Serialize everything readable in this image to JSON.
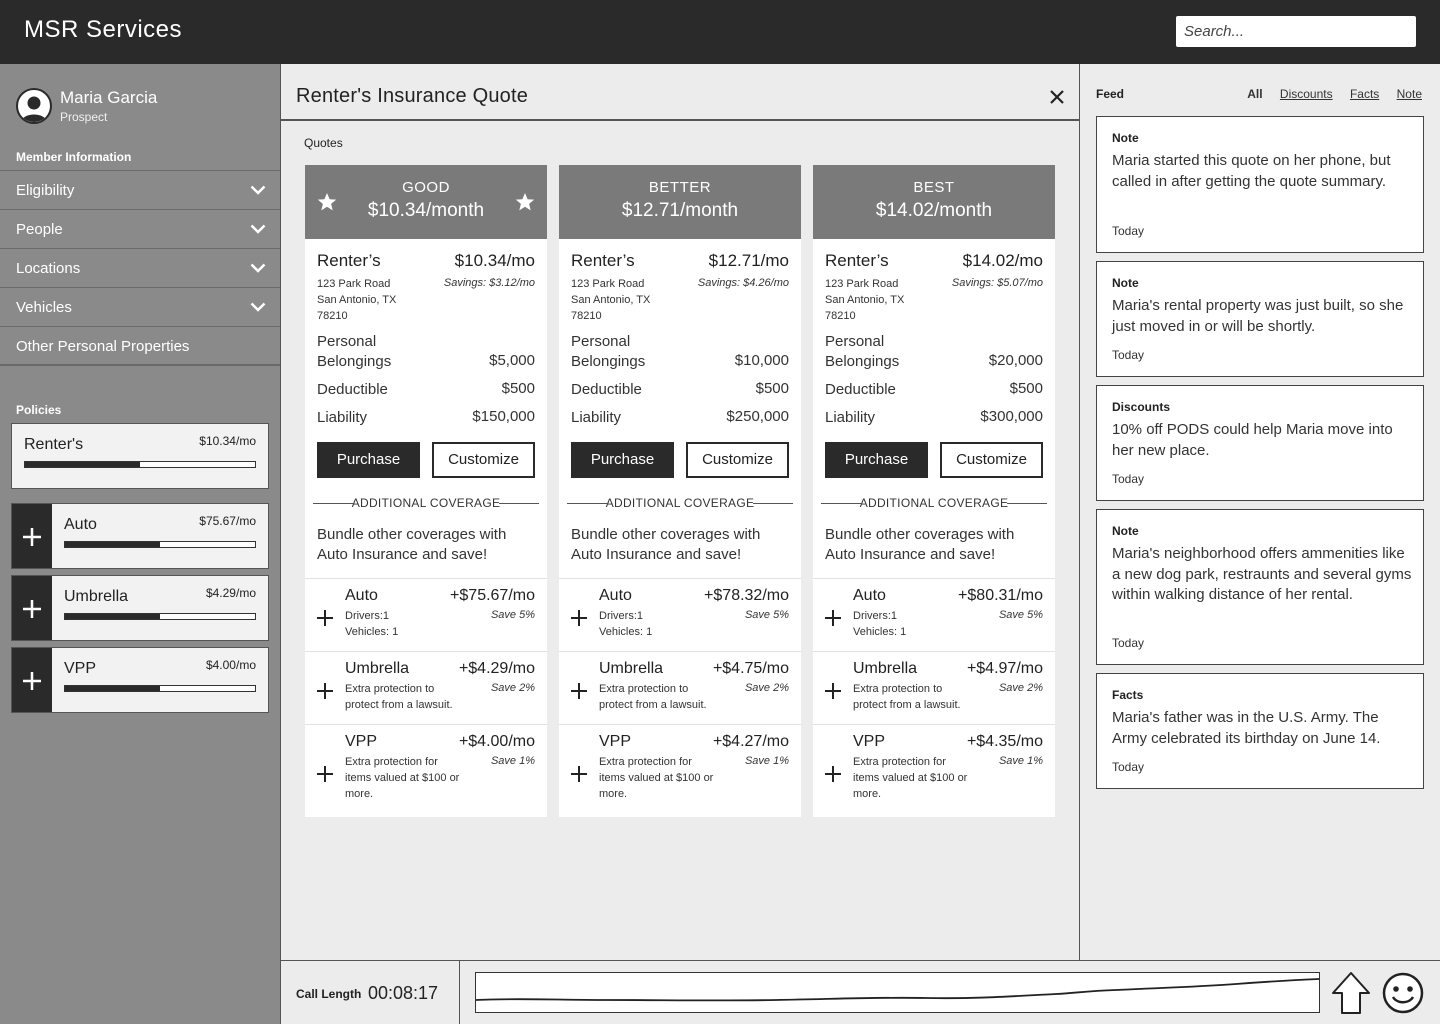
{
  "app": {
    "title": "MSR Services",
    "search_placeholder": "Search..."
  },
  "member": {
    "name": "Maria Garcia",
    "role": "Prospect"
  },
  "sidebar": {
    "section_label": "Member Information",
    "items": [
      {
        "label": "Eligibility",
        "expandable": true
      },
      {
        "label": "People",
        "expandable": true
      },
      {
        "label": "Locations",
        "expandable": true
      },
      {
        "label": "Vehicles",
        "expandable": true
      },
      {
        "label": "Other Personal Properties",
        "expandable": false
      }
    ],
    "policies_label": "Policies",
    "policies": [
      {
        "name": "Renter's",
        "price": "$10.34/mo",
        "progress": 0.5,
        "addable": false
      },
      {
        "name": "Auto",
        "price": "$75.67/mo",
        "progress": 0.5,
        "addable": true
      },
      {
        "name": "Umbrella",
        "price": "$4.29/mo",
        "progress": 0.5,
        "addable": true
      },
      {
        "name": "VPP",
        "price": "$4.00/mo",
        "progress": 0.5,
        "addable": true
      }
    ]
  },
  "quote": {
    "title": "Renter's Insurance Quote",
    "quotes_label": "Quotes",
    "purchase_label": "Purchase",
    "customize_label": "Customize",
    "additional_coverage_label": "ADDITIONAL COVERAGE",
    "bundle_text": "Bundle other coverages with Auto Insurance and save!",
    "row_labels": {
      "belongings": "Personal Belongings",
      "deductible": "Deductible",
      "liability": "Liability"
    },
    "address": [
      "123 Park Road",
      "San Antonio, TX",
      "78210"
    ],
    "cards": [
      {
        "tier": "GOOD",
        "tier_price": "$10.34/month",
        "starred": true,
        "name": "Renter’s",
        "price": "$10.34/mo",
        "savings": "Savings: $3.12/mo",
        "belongings": "$5,000",
        "deductible": "$500",
        "liability": "$150,000",
        "coverages": [
          {
            "name": "Auto",
            "price": "+$75.67/mo",
            "desc": "Drivers:1\nVehicles: 1",
            "save": "Save 5%"
          },
          {
            "name": "Umbrella",
            "price": "+$4.29/mo",
            "desc": "Extra protection to protect from a lawsuit.",
            "save": "Save 2%"
          },
          {
            "name": "VPP",
            "price": "+$4.00/mo",
            "desc": "Extra protection for items valued at $100 or more.",
            "save": "Save 1%"
          }
        ]
      },
      {
        "tier": "BETTER",
        "tier_price": "$12.71/month",
        "starred": false,
        "name": "Renter’s",
        "price": "$12.71/mo",
        "savings": "Savings: $4.26/mo",
        "belongings": "$10,000",
        "deductible": "$500",
        "liability": "$250,000",
        "coverages": [
          {
            "name": "Auto",
            "price": "+$78.32/mo",
            "desc": "Drivers:1\nVehicles: 1",
            "save": "Save 5%"
          },
          {
            "name": "Umbrella",
            "price": "+$4.75/mo",
            "desc": "Extra protection to protect from a lawsuit.",
            "save": "Save 2%"
          },
          {
            "name": "VPP",
            "price": "+$4.27/mo",
            "desc": "Extra protection for items valued at $100 or more.",
            "save": "Save 1%"
          }
        ]
      },
      {
        "tier": "BEST",
        "tier_price": "$14.02/month",
        "starred": false,
        "name": "Renter’s",
        "price": "$14.02/mo",
        "savings": "Savings: $5.07/mo",
        "belongings": "$20,000",
        "deductible": "$500",
        "liability": "$300,000",
        "coverages": [
          {
            "name": "Auto",
            "price": "+$80.31/mo",
            "desc": "Drivers:1\nVehicles: 1",
            "save": "Save 5%"
          },
          {
            "name": "Umbrella",
            "price": "+$4.97/mo",
            "desc": "Extra protection to protect from a lawsuit.",
            "save": "Save 2%"
          },
          {
            "name": "VPP",
            "price": "+$4.35/mo",
            "desc": "Extra protection for items valued at $100 or more.",
            "save": "Save 1%"
          }
        ]
      }
    ]
  },
  "feed": {
    "title": "Feed",
    "tabs": [
      {
        "label": "All",
        "active": true
      },
      {
        "label": "Discounts",
        "active": false
      },
      {
        "label": "Facts",
        "active": false
      },
      {
        "label": "Note",
        "active": false
      }
    ],
    "items": [
      {
        "type": "Note",
        "text": "Maria started this quote on her phone, but called in after getting the quote summary.",
        "date": "Today"
      },
      {
        "type": "Note",
        "text": "Maria's rental property was just built, so she just moved in or will be shortly.",
        "date": "Today"
      },
      {
        "type": "Discounts",
        "text": "10% off PODS could help Maria move into her new place.",
        "date": "Today"
      },
      {
        "type": "Note",
        "text": "Maria's neighborhood offers ammenities like a new dog park, restraunts and several gyms within walking distance of her rental.",
        "date": "Today"
      },
      {
        "type": "Facts",
        "text": "Maria's father was in the U.S. Army. The Army celebrated its birthday on June 14.",
        "date": "Today"
      }
    ]
  },
  "call": {
    "label": "Call Length",
    "time": "00:08:17"
  },
  "icons": {
    "avatar": "user-avatar-icon",
    "chevron": "chevron-down-icon",
    "close": "close-icon",
    "star": "star-icon",
    "plus": "plus-icon",
    "upload": "arrow-up-icon",
    "sentiment": "smiley-face-icon"
  },
  "colors": {
    "topbar": "#2a2a2b",
    "sidebar": "#8a8a8a",
    "card_header": "#7a7a7a",
    "button_dark": "#2a2a2a"
  }
}
